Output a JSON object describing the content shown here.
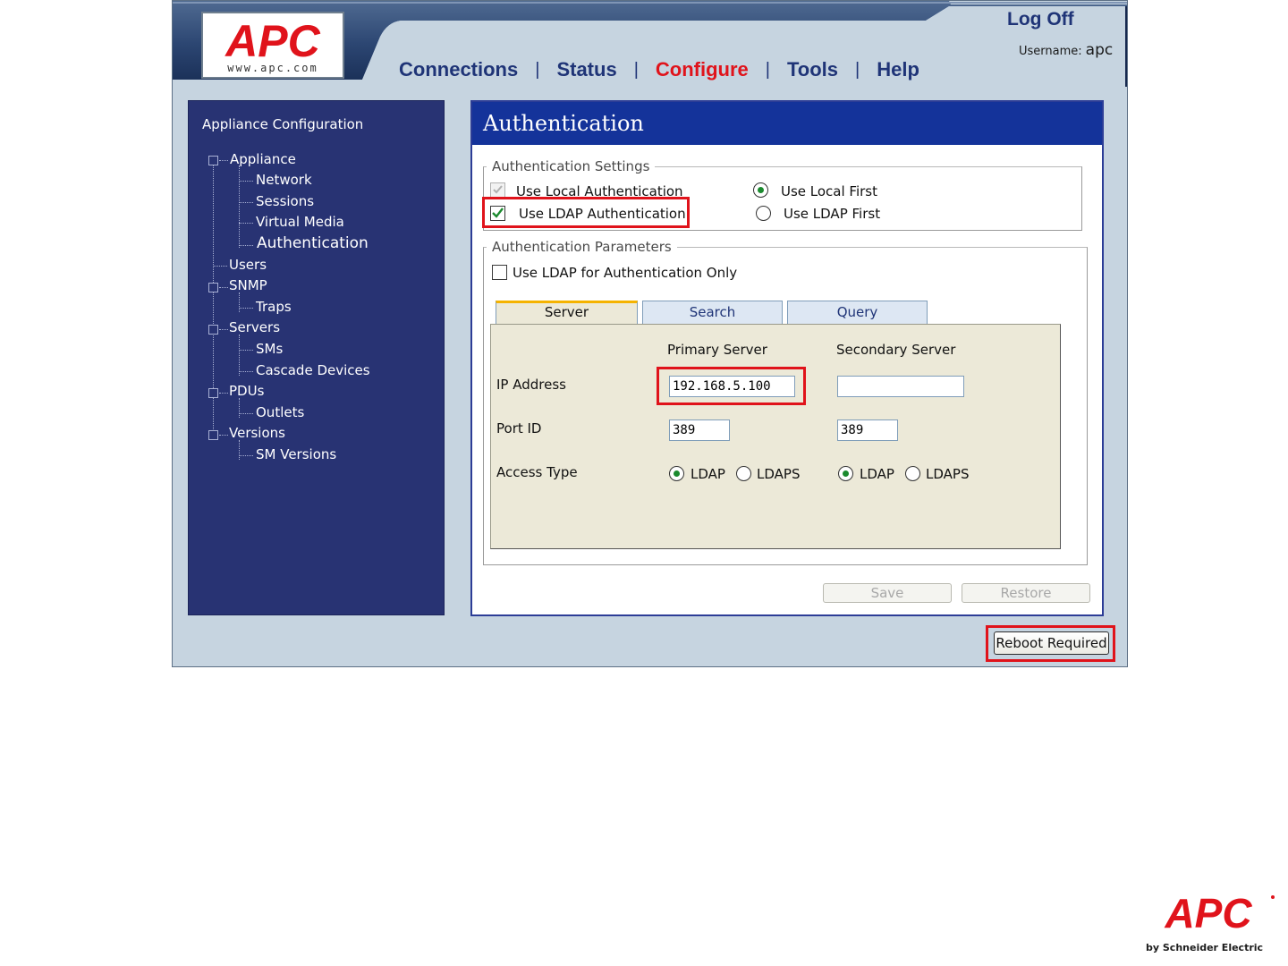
{
  "header": {
    "logo_text": "APC",
    "logo_url_text": "www.apc.com",
    "nav": [
      {
        "label": "Connections",
        "active": false
      },
      {
        "label": "Status",
        "active": false
      },
      {
        "label": "Configure",
        "active": true
      },
      {
        "label": "Tools",
        "active": false
      },
      {
        "label": "Help",
        "active": false
      }
    ],
    "nav_separator": "|",
    "logoff_label": "Log Off",
    "username_label": "Username:",
    "username_value": "apc"
  },
  "sidebar": {
    "title": "Appliance Configuration",
    "items": [
      {
        "label": "Appliance",
        "level": 0
      },
      {
        "label": "Network",
        "level": 1
      },
      {
        "label": "Sessions",
        "level": 1
      },
      {
        "label": "Virtual Media",
        "level": 1
      },
      {
        "label": "Authentication",
        "level": 1,
        "current": true
      },
      {
        "label": "Users",
        "level": 0
      },
      {
        "label": "SNMP",
        "level": 0
      },
      {
        "label": "Traps",
        "level": 1
      },
      {
        "label": "Servers",
        "level": 0
      },
      {
        "label": "SMs",
        "level": 1
      },
      {
        "label": "Cascade Devices",
        "level": 1
      },
      {
        "label": "PDUs",
        "level": 0
      },
      {
        "label": "Outlets",
        "level": 1
      },
      {
        "label": "Versions",
        "level": 0
      },
      {
        "label": "SM Versions",
        "level": 1
      }
    ]
  },
  "main": {
    "title": "Authentication",
    "auth_settings": {
      "legend": "Authentication Settings",
      "use_local_label": "Use Local Authentication",
      "use_local_checked": true,
      "use_local_disabled": true,
      "use_ldap_label": "Use LDAP Authentication",
      "use_ldap_checked": true,
      "local_first_label": "Use Local First",
      "local_first_selected": true,
      "ldap_first_label": "Use LDAP First",
      "ldap_first_selected": false
    },
    "auth_params": {
      "legend": "Authentication Parameters",
      "ldap_only_label": "Use LDAP for Authentication Only",
      "ldap_only_checked": false,
      "tabs": [
        {
          "label": "Server",
          "active": true
        },
        {
          "label": "Search",
          "active": false
        },
        {
          "label": "Query",
          "active": false
        }
      ],
      "server": {
        "primary_header": "Primary Server",
        "secondary_header": "Secondary Server",
        "ip_label": "IP Address",
        "primary_ip": "192.168.5.100",
        "secondary_ip": "",
        "port_label": "Port ID",
        "primary_port": "389",
        "secondary_port": "389",
        "access_label": "Access Type",
        "ldap_label": "LDAP",
        "ldaps_label": "LDAPS",
        "primary_access": "LDAP",
        "secondary_access": "LDAP"
      }
    },
    "save_label": "Save",
    "restore_label": "Restore"
  },
  "footer": {
    "reboot_label": "Reboot Required"
  },
  "brand_logo": {
    "text": "APC",
    "byline": "by Schneider Electric"
  },
  "colors": {
    "brand_red": "#e0131b",
    "nav_blue": "#1f3477",
    "sidebar_bg": "#283373",
    "title_bar": "#14339a",
    "radio_dot": "#1b8a2e",
    "schneider_green": "#3dcd58"
  }
}
